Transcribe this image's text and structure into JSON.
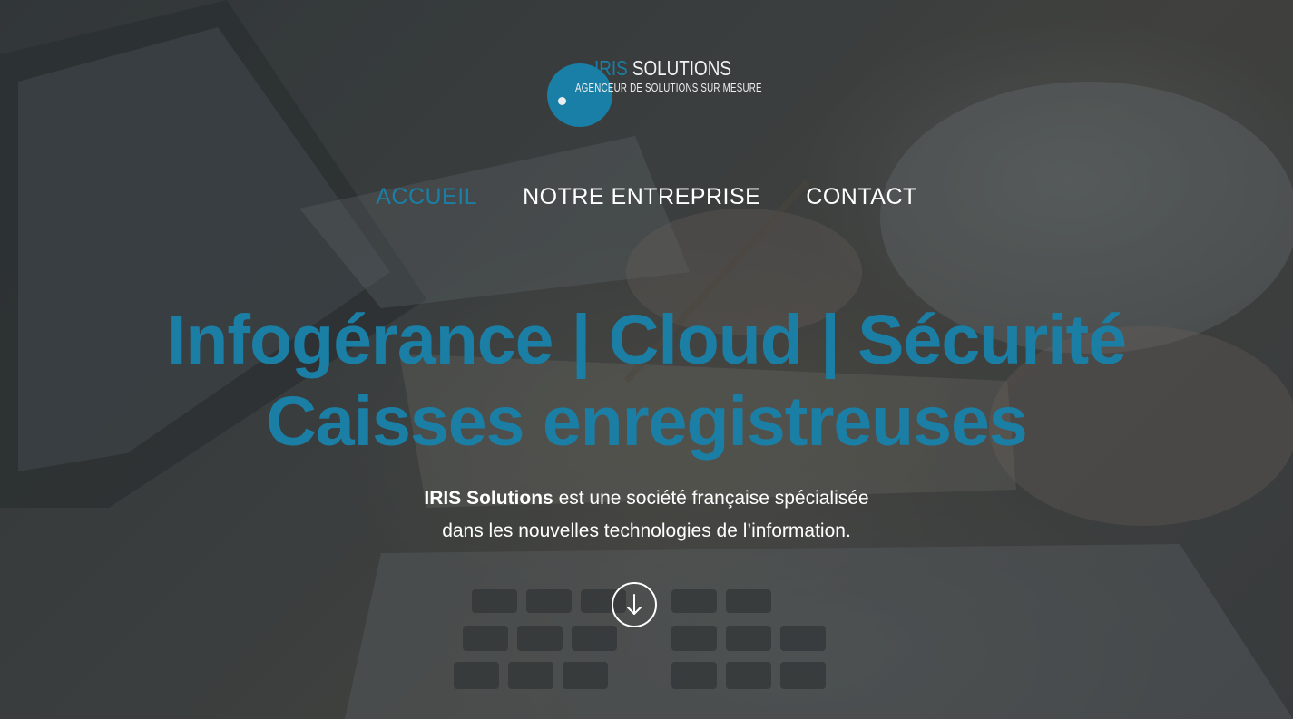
{
  "logo": {
    "brand_prefix": "IRIS",
    "brand_suffix": " SOLUTIONS",
    "tagline": "AGENCEUR DE SOLUTIONS SUR MESURE"
  },
  "nav": {
    "items": [
      {
        "label": "ACCUEIL",
        "active": true
      },
      {
        "label": "NOTRE ENTREPRISE",
        "active": false
      },
      {
        "label": "CONTACT",
        "active": false
      }
    ]
  },
  "hero": {
    "headline_line1": "Infogérance | Cloud | Sécurité",
    "headline_line2": "Caisses enregistreuses",
    "intro_company": "IRIS Solutions",
    "intro_line1_rest": " est une société française spécialisée",
    "intro_line2": "dans les nouvelles technologies de l’information.",
    "scroll_icon": "arrow-down-circle-icon"
  },
  "colors": {
    "accent": "#1a7fa6",
    "text": "#ffffff",
    "overlay": "#2c3133"
  }
}
